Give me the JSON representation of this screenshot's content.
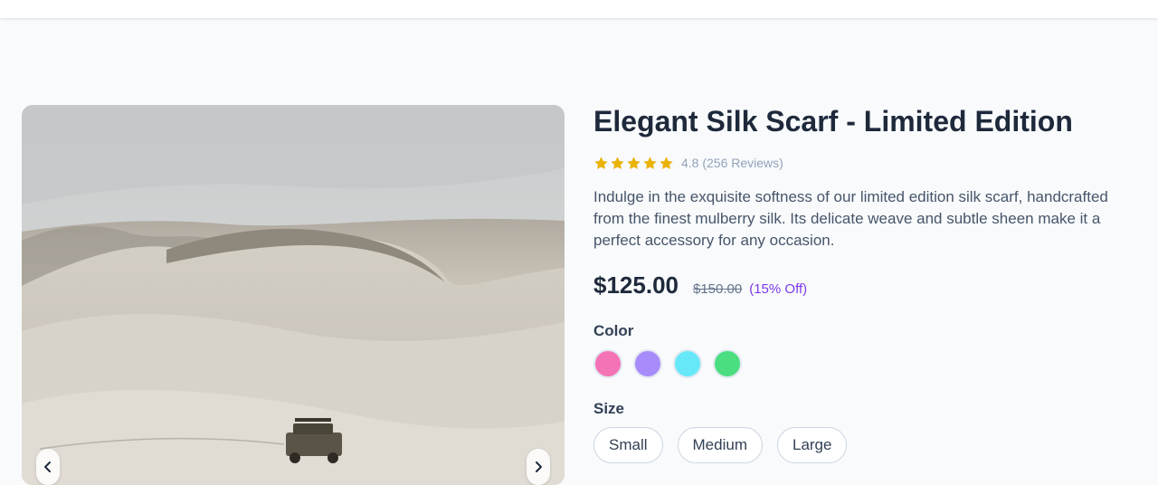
{
  "product": {
    "title": "Elegant Silk Scarf - Limited Edition",
    "rating": 4.8,
    "stars_filled": 5,
    "star_color": "#eab308",
    "rating_text": "4.8 (256 Reviews)",
    "description": "Indulge in the exquisite softness of our limited edition silk scarf, handcrafted from the finest mulberry silk. Its delicate weave and subtle sheen make it a perfect accessory for any occasion.",
    "price": "$125.00",
    "original_price": "$150.00",
    "discount": "(15% Off)"
  },
  "gallery": {
    "prev_icon": "chevron-left-icon",
    "next_icon": "chevron-right-icon"
  },
  "color": {
    "label": "Color",
    "options": [
      {
        "name": "pink",
        "hex": "#f472b6"
      },
      {
        "name": "purple",
        "hex": "#a78bfa"
      },
      {
        "name": "cyan",
        "hex": "#67e8f9"
      },
      {
        "name": "green",
        "hex": "#4ade80"
      }
    ]
  },
  "size": {
    "label": "Size",
    "options": [
      "Small",
      "Medium",
      "Large"
    ]
  },
  "colors": {
    "accent": "#7c3aed",
    "background": "#f8fafc"
  }
}
